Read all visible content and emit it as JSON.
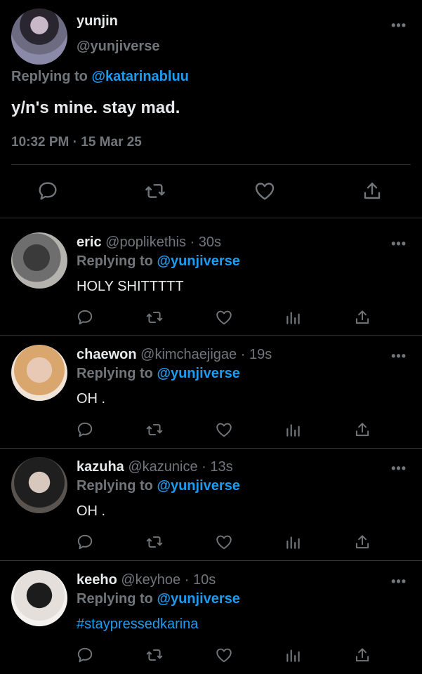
{
  "main_tweet": {
    "name": "yunjin",
    "handle": "@yunjiverse",
    "replying_prefix": "Replying to",
    "replying_mention": "@katarinabluu",
    "text": "y/n's mine. stay mad.",
    "timestamp": "10:32 PM · 15 Mar 25",
    "more": "•••"
  },
  "replies": [
    {
      "name": "eric",
      "handle": "@poplikethis",
      "time": "30s",
      "replying_prefix": "Replying to",
      "replying_mention": "@yunjiverse",
      "text": "HOLY SHITTTTT",
      "more": "•••"
    },
    {
      "name": "chaewon",
      "handle": "@kimchaejigae",
      "time": "19s",
      "replying_prefix": "Replying to",
      "replying_mention": "@yunjiverse",
      "text": "OH .",
      "more": "•••"
    },
    {
      "name": "kazuha",
      "handle": "@kazunice",
      "time": "13s",
      "replying_prefix": "Replying to",
      "replying_mention": "@yunjiverse",
      "text": "OH .",
      "more": "•••"
    },
    {
      "name": "keeho",
      "handle": "@keyhoe",
      "time": "10s",
      "replying_prefix": "Replying to",
      "replying_mention": "@yunjiverse",
      "text": "#staypressedkarina",
      "more": "•••"
    }
  ],
  "separator": " · ",
  "icons": [
    "reply-icon",
    "retweet-icon",
    "like-icon",
    "analytics-icon",
    "share-icon"
  ],
  "colors": {
    "background": "#000000",
    "text": "#e7e9ea",
    "muted": "#71767b",
    "accent": "#1d9bf0",
    "divider": "#2f3336"
  }
}
